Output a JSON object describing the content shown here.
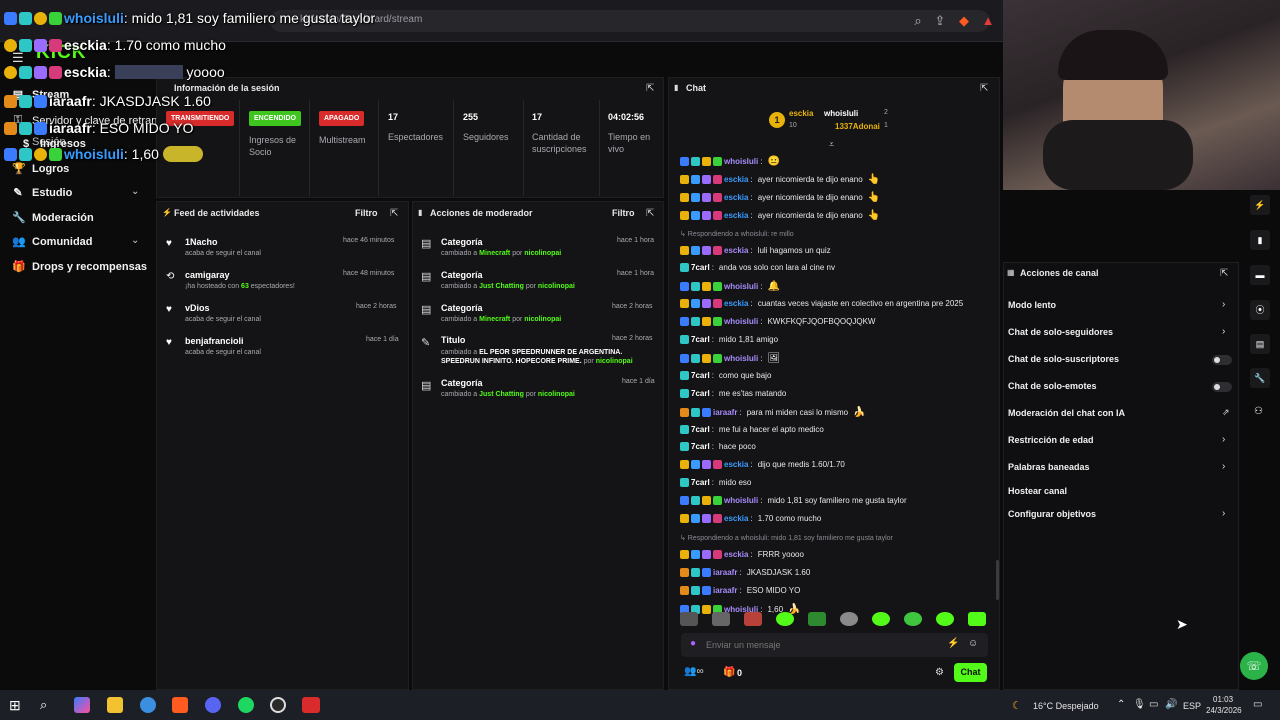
{
  "browser": {
    "url": "kick.com/dashboard/stream",
    "icons": [
      "search-icon",
      "share-icon",
      "brave-icon",
      "alert-icon"
    ]
  },
  "overlay": {
    "logo": "KICK",
    "lines": [
      {
        "user": "whoisluli",
        "text": ": mido 1,81 soy familiero me gusta taylor",
        "color": "#3a9bff"
      },
      {
        "user": "esckia",
        "text": ": 1.70 como mucho",
        "color": "#ffffff"
      },
      {
        "user": "esckia",
        "text": ": yoooo",
        "color": "#ffffff"
      },
      {
        "user": "iaraafr",
        "text": ": JKASDJASK 1.60",
        "color": "#ffffff"
      },
      {
        "user": "iaraafr",
        "text": ": ESO MIDO YO",
        "color": "#ffffff"
      },
      {
        "user": "whoisluli",
        "text": ": 1,60",
        "color": "#3a9bff"
      }
    ]
  },
  "sidebar": {
    "items": [
      {
        "label": "Stream",
        "icon": "stream-icon"
      },
      {
        "label": "Servidor y clave de retransm",
        "icon": "key-icon"
      },
      {
        "label": "Sesión",
        "icon": "session-icon"
      },
      {
        "label": "Ingresos",
        "icon": "money-icon"
      },
      {
        "label": "Logros",
        "icon": "trophy-icon"
      },
      {
        "label": "Estudio",
        "icon": "studio-icon"
      },
      {
        "label": "Moderación",
        "icon": "wrench-icon"
      },
      {
        "label": "Comunidad",
        "icon": "users-icon"
      },
      {
        "label": "Drops y recompensas",
        "icon": "gift-icon"
      }
    ]
  },
  "session": {
    "title": "Información de la sesión",
    "pills": [
      {
        "label": "TRANSMITIENDO",
        "color": "#d92b2b"
      },
      {
        "label": "ENCENDIDO",
        "color": "#3ec61f"
      },
      {
        "label": "APAGADO",
        "color": "#d92b2b"
      }
    ],
    "pill_captions": [
      "Ingresos de Socio",
      "Multistream"
    ],
    "stats": [
      {
        "value": "17",
        "label": "Espectadores"
      },
      {
        "value": "255",
        "label": "Seguidores"
      },
      {
        "value": "17",
        "label": "Cantidad de suscripciones"
      },
      {
        "value": "04:02:56",
        "label": "Tiempo en vivo"
      }
    ]
  },
  "feed": {
    "title": "Feed de actividades",
    "filter": "Filtro",
    "items": [
      {
        "name": "1Nacho",
        "sub": "acaba de seguir el canal",
        "time": "hace 46 minutos",
        "icon": "heart-icon"
      },
      {
        "name": "camigaray",
        "sub_pre": "¡ha hosteado con ",
        "sub_hl": "63",
        "sub_post": " espectadores!",
        "time": "hace 48 minutos",
        "icon": "host-icon"
      },
      {
        "name": "vDios",
        "sub": "acaba de seguir el canal",
        "time": "hace 2 horas",
        "icon": "heart-icon"
      },
      {
        "name": "benjafrancioli",
        "sub": "acaba de seguir el canal",
        "time": "hace 1 día",
        "icon": "heart-icon"
      }
    ]
  },
  "modactions": {
    "title": "Acciones de moderador",
    "filter": "Filtro",
    "items": [
      {
        "name": "Categoría",
        "pre": "cambiado a ",
        "target": "Minecraft",
        "mid": " por ",
        "by": "nicolinopai",
        "time": "hace 1 hora"
      },
      {
        "name": "Categoría",
        "pre": "cambiado a ",
        "target": "Just Chatting",
        "mid": " por ",
        "by": "nicolinopai",
        "time": "hace 1 hora"
      },
      {
        "name": "Categoría",
        "pre": "cambiado a ",
        "target": "Minecraft",
        "mid": " por ",
        "by": "nicolinopai",
        "time": "hace 2 horas"
      },
      {
        "name": "Titulo",
        "pre": "cambiado a ",
        "target": "EL PEOR SPEEDRUNNER DE ARGENTINA. SPEEDRUN INFINITO. HOPECORE PRIME.",
        "mid": " por ",
        "by": "nicolinopai",
        "time": "hace 2 horas"
      },
      {
        "name": "Categoría",
        "pre": "cambiado a ",
        "target": "Just Chatting",
        "mid": " por ",
        "by": "nicolinopai",
        "time": "hace 1 día"
      }
    ]
  },
  "chat": {
    "title": "Chat",
    "gifters": [
      {
        "rank": "1",
        "name": "esckia",
        "count": "10"
      },
      {
        "name": "whoisluli",
        "count": "2"
      },
      {
        "name": "1337Adonai",
        "count": "1"
      }
    ],
    "messages": [
      {
        "type": "msg",
        "user": "whoisluli",
        "color": "#a78bfa",
        "text": "",
        "emoji": "😐"
      },
      {
        "type": "msg",
        "user": "esckia",
        "color": "#3a9bff",
        "text": "ayer nicomierda te dijo enano",
        "emoji": "👆"
      },
      {
        "type": "msg",
        "user": "esckia",
        "color": "#3a9bff",
        "text": "ayer nicomierda te dijo enano",
        "emoji": "👆"
      },
      {
        "type": "msg",
        "user": "esckia",
        "color": "#3a9bff",
        "text": "ayer nicomierda te dijo enano",
        "emoji": "👆"
      },
      {
        "type": "reply",
        "text": "Respondiendo a whoisluli: re millo"
      },
      {
        "type": "msg",
        "user": "esckia",
        "color": "#a78bfa",
        "text": "luli hagamos un quiz",
        "emoji": ""
      },
      {
        "type": "msg",
        "user": "7carl",
        "color": "#ffffff",
        "text": "anda vos solo con lara al cine nv",
        "emoji": ""
      },
      {
        "type": "msg",
        "user": "whoisluli",
        "color": "#a78bfa",
        "text": "",
        "emoji": "🔔"
      },
      {
        "type": "msg",
        "user": "esckia",
        "color": "#3a9bff",
        "text": "cuantas veces viajaste en colectivo en argentina pre 2025",
        "emoji": ""
      },
      {
        "type": "msg",
        "user": "whoisluli",
        "color": "#a78bfa",
        "text": "KWKFKQFJQOFBQOQJQKW",
        "emoji": ""
      },
      {
        "type": "msg",
        "user": "7carl",
        "color": "#ffffff",
        "text": "mido 1,81 amigo",
        "emoji": ""
      },
      {
        "type": "msg",
        "user": "whoisluli",
        "color": "#a78bfa",
        "text": "",
        "emoji": "🖼"
      },
      {
        "type": "msg",
        "user": "7carl",
        "color": "#ffffff",
        "text": "como que bajo",
        "emoji": ""
      },
      {
        "type": "msg",
        "user": "7carl",
        "color": "#ffffff",
        "text": "me es'tas matando",
        "emoji": ""
      },
      {
        "type": "msg",
        "user": "iaraafr",
        "color": "#a78bfa",
        "text": "para mi miden casi lo mismo",
        "emoji": "🍌"
      },
      {
        "type": "msg",
        "user": "7carl",
        "color": "#ffffff",
        "text": "me fui a hacer el apto medico",
        "emoji": ""
      },
      {
        "type": "msg",
        "user": "7carl",
        "color": "#ffffff",
        "text": "hace poco",
        "emoji": ""
      },
      {
        "type": "msg",
        "user": "esckia",
        "color": "#3a9bff",
        "text": "dijo que medis 1.60/1.70",
        "emoji": ""
      },
      {
        "type": "msg",
        "user": "7carl",
        "color": "#ffffff",
        "text": "mido eso",
        "emoji": ""
      },
      {
        "type": "msg",
        "user": "whoisluli",
        "color": "#a78bfa",
        "text": "mido 1,81 soy familiero me gusta taylor",
        "emoji": ""
      },
      {
        "type": "msg",
        "user": "esckia",
        "color": "#3a9bff",
        "text": "1.70 como mucho",
        "emoji": ""
      },
      {
        "type": "reply",
        "text": "Respondiendo a whoisluli: mido 1,81 soy familiero me gusta taylor"
      },
      {
        "type": "msg",
        "user": "esckia",
        "color": "#a78bfa",
        "text": "FRRR yoooo",
        "emoji": ""
      },
      {
        "type": "msg",
        "user": "iaraafr",
        "color": "#a78bfa",
        "text": "JKASDJASK 1.60",
        "emoji": ""
      },
      {
        "type": "msg",
        "user": "iaraafr",
        "color": "#a78bfa",
        "text": "ESO MIDO YO",
        "emoji": ""
      },
      {
        "type": "msg",
        "user": "whoisluli",
        "color": "#a78bfa",
        "text": "1,60",
        "emoji": "🍌"
      }
    ],
    "placeholder": "Enviar un mensaje",
    "send_label": "Chat",
    "viewer_count": "0"
  },
  "actions": {
    "title": "Acciones de canal",
    "items": [
      {
        "label": "Modo lento",
        "control": "chevron"
      },
      {
        "label": "Chat de solo-seguidores",
        "control": "chevron"
      },
      {
        "label": "Chat de solo-suscriptores",
        "control": "toggle"
      },
      {
        "label": "Chat de solo-emotes",
        "control": "toggle"
      },
      {
        "label": "Moderación del chat con IA",
        "control": "external"
      },
      {
        "label": "Restricción de edad",
        "control": "chevron"
      },
      {
        "label": "Palabras baneadas",
        "control": "chevron"
      },
      {
        "label": "Hostear canal",
        "control": "none"
      },
      {
        "label": "Configurar objetivos",
        "control": "chevron"
      }
    ]
  },
  "taskbar": {
    "weather": "16°C Despejado",
    "lang": "ESP",
    "time": "01:03",
    "date": "24/3/2026"
  },
  "colors": {
    "accent": "#53fc18",
    "danger": "#d92b2b",
    "bg": "#0b0b0c",
    "panel": "#141416"
  }
}
